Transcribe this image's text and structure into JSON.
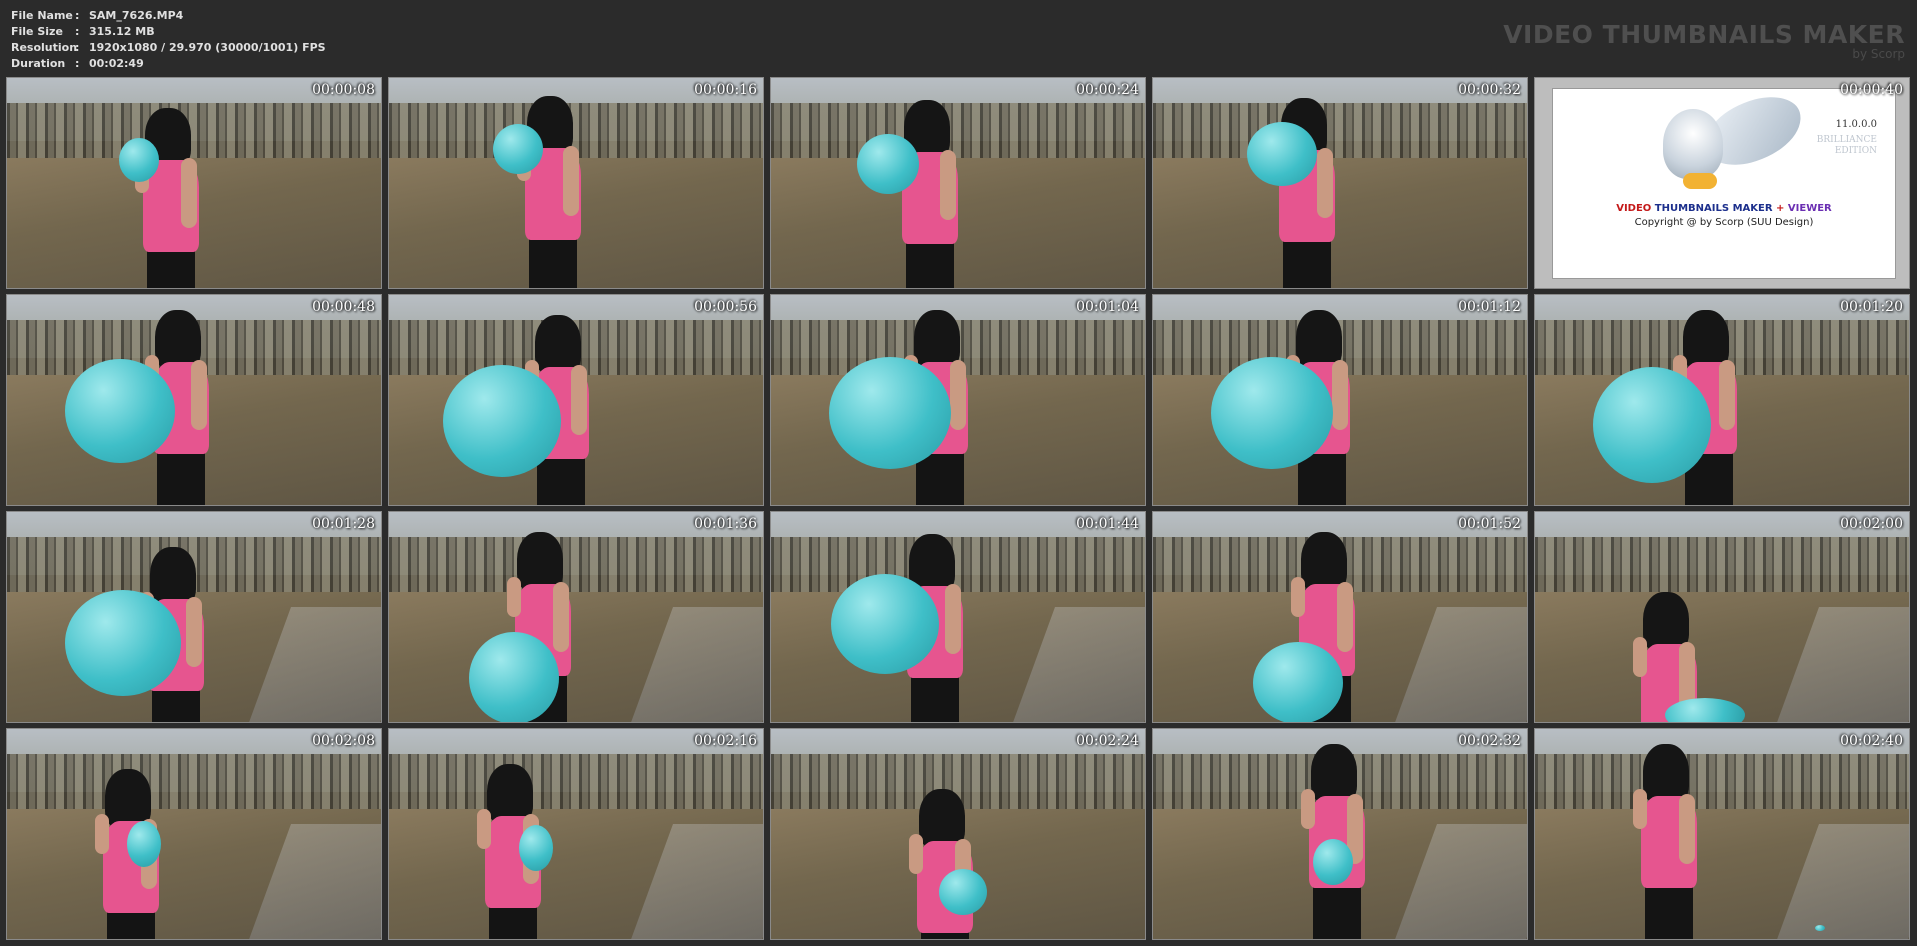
{
  "file_info": [
    {
      "label": "File Name",
      "sep": ":",
      "value": "SAM_7626.MP4"
    },
    {
      "label": "File Size",
      "sep": ":",
      "value": "315.12 MB"
    },
    {
      "label": "Resolution",
      "sep": ":",
      "value": "1920x1080 / 29.970 (30000/1001) FPS"
    },
    {
      "label": "Duration",
      "sep": ":",
      "value": "00:02:49"
    }
  ],
  "brand": {
    "title": "VIDEO THUMBNAILS MAKER",
    "subtitle": "by Scorp"
  },
  "logo": {
    "version": "11.0.0.0",
    "edition_line1": "BRILLIANCE",
    "edition_line2": "EDITION",
    "name_part1": "VIDEO",
    "name_part2": "THUMBNAILS MAKER",
    "name_plus": "+",
    "name_part3": "VIEWER",
    "copyright": "Copyright @ by Scorp (SUU Design)"
  },
  "thumbnails": [
    {
      "timestamp": "00:00:08"
    },
    {
      "timestamp": "00:00:16"
    },
    {
      "timestamp": "00:00:24"
    },
    {
      "timestamp": "00:00:32"
    },
    {
      "timestamp": "00:00:40",
      "is_logo": true
    },
    {
      "timestamp": "00:00:48"
    },
    {
      "timestamp": "00:00:56"
    },
    {
      "timestamp": "00:01:04"
    },
    {
      "timestamp": "00:01:12"
    },
    {
      "timestamp": "00:01:20"
    },
    {
      "timestamp": "00:01:28"
    },
    {
      "timestamp": "00:01:36"
    },
    {
      "timestamp": "00:01:44"
    },
    {
      "timestamp": "00:01:52"
    },
    {
      "timestamp": "00:02:00"
    },
    {
      "timestamp": "00:02:08"
    },
    {
      "timestamp": "00:02:16"
    },
    {
      "timestamp": "00:02:24"
    },
    {
      "timestamp": "00:02:32"
    },
    {
      "timestamp": "00:02:40"
    }
  ],
  "colors": {
    "background": "#2b2b2b",
    "balloon": "#3fbfc8",
    "top": "#e6558f"
  }
}
